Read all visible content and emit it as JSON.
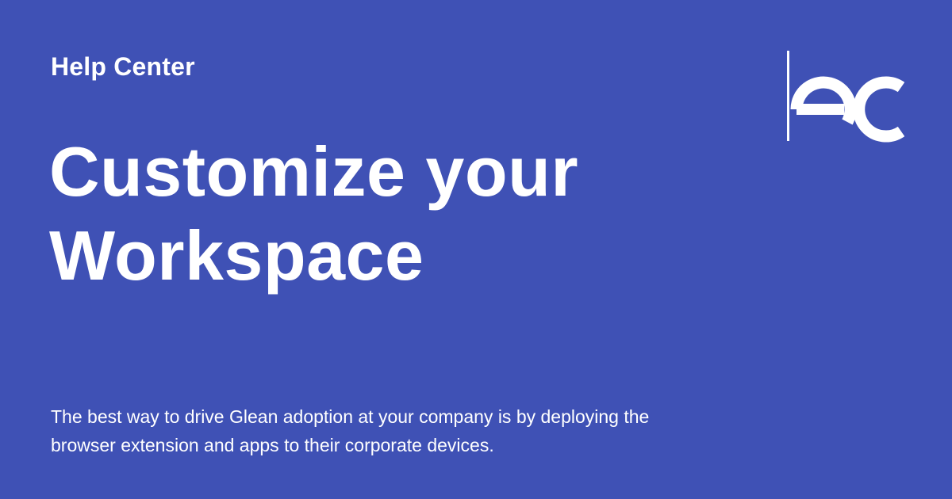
{
  "page": {
    "section_label": "Help Center",
    "title": "Customize your Workspace",
    "description": "The best way to drive Glean adoption at your company is by deploying the browser extension and apps to their corporate devices."
  },
  "logo": {
    "icon": "glean-logo-icon"
  },
  "colors": {
    "background": "#3f51b5",
    "text": "#ffffff"
  }
}
